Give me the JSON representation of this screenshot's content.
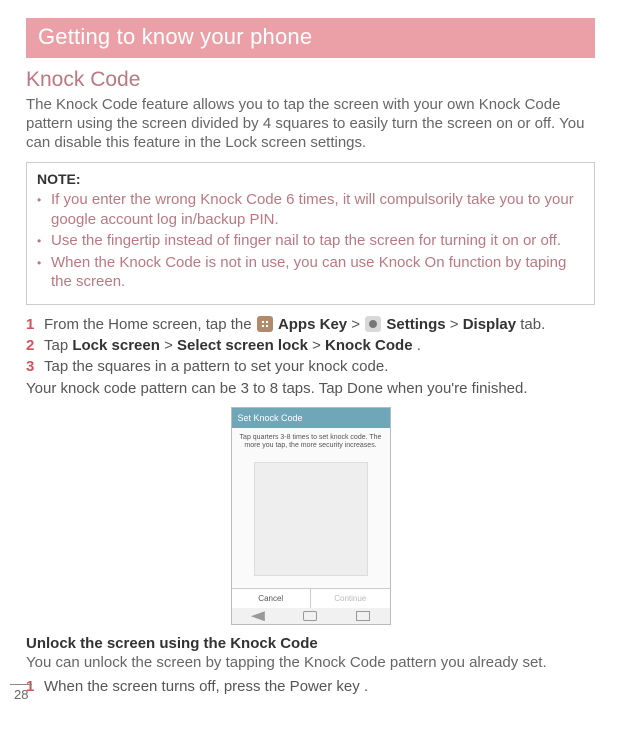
{
  "header": "Getting to know your phone",
  "section_title": "Knock Code",
  "intro": "The Knock Code feature allows you to tap the screen with your own Knock Code pattern using the screen divided by 4 squares to easily turn the screen on or off. You can disable this feature in the Lock screen settings.",
  "note": {
    "label": "NOTE:",
    "items": [
      "If you enter the wrong Knock Code 6 times, it will compulsorily take you to your google account log in/backup PIN.",
      "Use the fingertip instead of finger nail to tap the screen for turning it on or off.",
      "When the Knock Code is not in use, you can use Knock On function by taping the screen."
    ]
  },
  "steps": [
    {
      "num": "1",
      "pre": "From the Home screen, tap the ",
      "apps_label": "Apps Key",
      "mid1": " > ",
      "settings_label": "Settings",
      "mid2": " > ",
      "display_label": "Display",
      "post": " tab."
    },
    {
      "num": "2",
      "pre": "Tap ",
      "b1": "Lock screen",
      "mid1": " > ",
      "b2": "Select screen lock",
      "mid2": " > ",
      "b3": "Knock Code",
      "post": "."
    },
    {
      "num": "3",
      "text": "Tap the squares in a pattern to set your knock code."
    }
  ],
  "after_steps": "Your knock code pattern can be 3 to 8 taps. Tap Done when you're finished.",
  "device": {
    "title": "Set Knock Code",
    "hint": "Tap quarters 3-8 times to set knock code. The more you tap, the more security increases.",
    "cancel": "Cancel",
    "continue": "Continue"
  },
  "subsection_title": "Unlock the screen using the Knock Code",
  "subsection_text": "You can unlock the screen by tapping the Knock Code pattern you already set.",
  "substeps": [
    {
      "num": "1",
      "text": "When the screen turns off, press the Power key ."
    }
  ],
  "page_number": "28"
}
